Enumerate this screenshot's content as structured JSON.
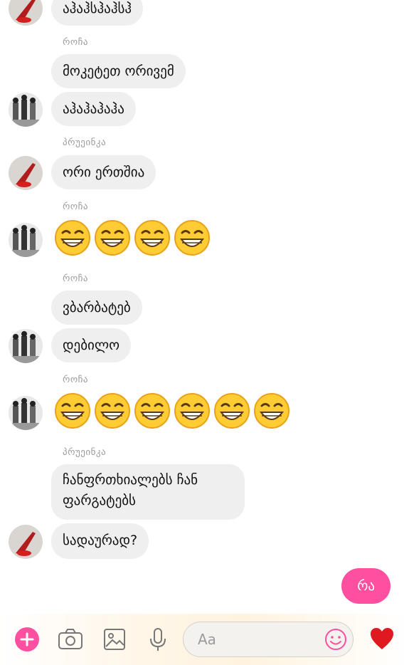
{
  "messages": [
    {
      "sender": "",
      "text": "აჰაჰსჰაჰსჰ",
      "avatar": "red-shoe-avatar"
    },
    {
      "sender": "როჩა",
      "text": "მოკეტეთ ორივემ"
    },
    {
      "sender": "",
      "text": "აჰაჰაჰაჰა",
      "avatar": "group-photo-avatar"
    },
    {
      "sender": "პრუეინკა",
      "text": "ორი ერთშია",
      "avatar": "red-shoe-avatar"
    },
    {
      "sender": "როჩა",
      "emoji_count": 4,
      "emoji": "grinning-face-with-smiling-eyes",
      "avatar": "group-photo-avatar"
    },
    {
      "sender": "როჩა",
      "text": "ვბარბატებ"
    },
    {
      "sender": "",
      "text": "დებილო",
      "avatar": "group-photo-avatar"
    },
    {
      "sender": "როჩა",
      "emoji_count": 6,
      "emoji": "grinning-face-with-smiling-eyes",
      "avatar": "group-photo-avatar"
    },
    {
      "sender": "პრუეინკა",
      "text": "ჩანფრთხიალებს ჩან ფარგატებს"
    },
    {
      "sender": "",
      "text": "სადაურად?",
      "avatar": "red-shoe-avatar"
    }
  ],
  "outgoing": {
    "text": "რა",
    "color": "#ff4fa0"
  },
  "composer": {
    "placeholder": "Aa",
    "icons": [
      "add-icon",
      "camera-icon",
      "image-icon",
      "microphone-icon",
      "emoji-icon",
      "heart-icon"
    ],
    "accent": "#ff4fa0"
  }
}
